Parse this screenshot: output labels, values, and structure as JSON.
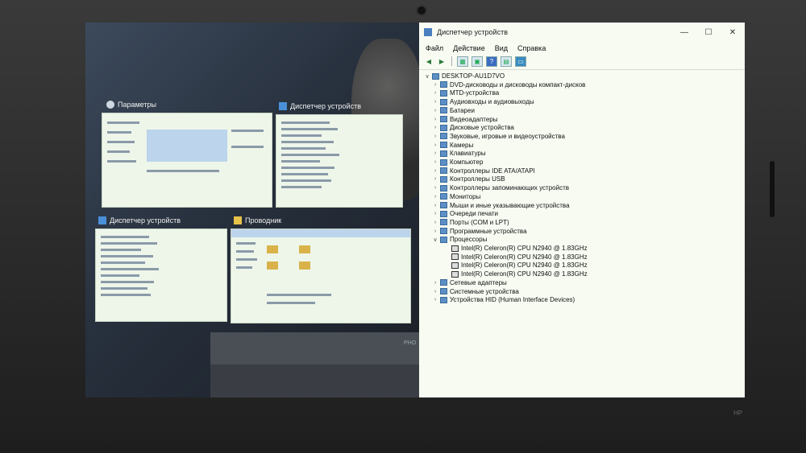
{
  "thumbnails": [
    {
      "title": "Параметры",
      "icon": "gear-icon"
    },
    {
      "title": "Диспетчер устройств",
      "icon": "device-manager-icon"
    },
    {
      "title": "Диспетчер устройств",
      "icon": "device-manager-icon"
    },
    {
      "title": "Проводник",
      "icon": "folder-icon"
    }
  ],
  "wallpaper_text": "PHO",
  "device_manager": {
    "title": "Диспетчер устройств",
    "window_controls": {
      "minimize": "—",
      "maximize": "☐",
      "close": "✕"
    },
    "menu": [
      "Файл",
      "Действие",
      "Вид",
      "Справка"
    ],
    "toolbar": [
      "back-icon",
      "forward-icon",
      "properties-icon",
      "show-hidden-icon",
      "help-icon",
      "monitor-icon"
    ],
    "tree": {
      "root": "DESKTOP-AU1D7VO",
      "categories": [
        "DVD-дисководы и дисководы компакт-дисков",
        "MTD-устройства",
        "Аудиовходы и аудиовыходы",
        "Батареи",
        "Видеоадаптеры",
        "Дисковые устройства",
        "Звуковые, игровые и видеоустройства",
        "Камеры",
        "Клавиатуры",
        "Компьютер",
        "Контроллеры IDE ATA/ATAPI",
        "Контроллеры USB",
        "Контроллеры запоминающих устройств",
        "Мониторы",
        "Мыши и иные указывающие устройства",
        "Очереди печати",
        "Порты (COM и LPT)",
        "Программные устройства",
        "Процессоры"
      ],
      "processors": [
        "Intel(R) Celeron(R) CPU  N2940  @ 1.83GHz",
        "Intel(R) Celeron(R) CPU  N2940  @ 1.83GHz",
        "Intel(R) Celeron(R) CPU  N2940  @ 1.83GHz",
        "Intel(R) Celeron(R) CPU  N2940  @ 1.83GHz"
      ],
      "after": [
        "Сетевые адаптеры",
        "Системные устройства",
        "Устройства HID (Human Interface Devices)"
      ]
    }
  },
  "bezel_logo": "HP"
}
